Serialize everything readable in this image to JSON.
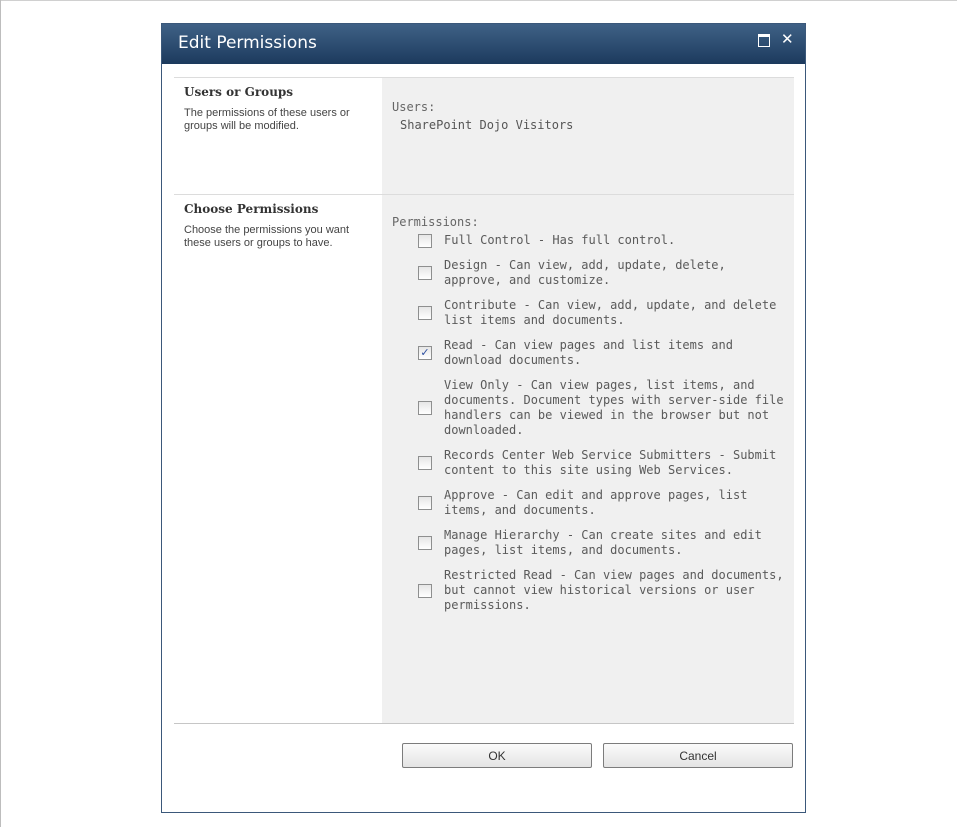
{
  "dialog": {
    "title": "Edit Permissions",
    "icons": {
      "maximize": "maximize-icon",
      "close": "close-icon"
    }
  },
  "users_section": {
    "title": "Users or Groups",
    "description": "The permissions of these users or groups will be modified.",
    "label": "Users:",
    "value": "SharePoint Dojo Visitors"
  },
  "permissions_section": {
    "title": "Choose Permissions",
    "description": "Choose the permissions you want these users or groups to have.",
    "label": "Permissions:",
    "options": [
      {
        "text": "Full Control - Has full control.",
        "checked": false
      },
      {
        "text": "Design - Can view, add, update, delete, approve, and customize.",
        "checked": false
      },
      {
        "text": "Contribute - Can view, add, update, and delete list items and documents.",
        "checked": false
      },
      {
        "text": "Read - Can view pages and list items and download documents.",
        "checked": true
      },
      {
        "text": "View Only - Can view pages, list items, and documents. Document types with server-side file handlers can be viewed in the browser but not downloaded.",
        "checked": false
      },
      {
        "text": "Records Center Web Service Submitters - Submit content to this site using Web Services.",
        "checked": false
      },
      {
        "text": "Approve - Can edit and approve pages, list items, and documents.",
        "checked": false
      },
      {
        "text": "Manage Hierarchy - Can create sites and edit pages, list items, and documents.",
        "checked": false
      },
      {
        "text": "Restricted Read - Can view pages and documents, but cannot view historical versions or user permissions.",
        "checked": false
      }
    ]
  },
  "buttons": {
    "ok": "OK",
    "cancel": "Cancel"
  }
}
